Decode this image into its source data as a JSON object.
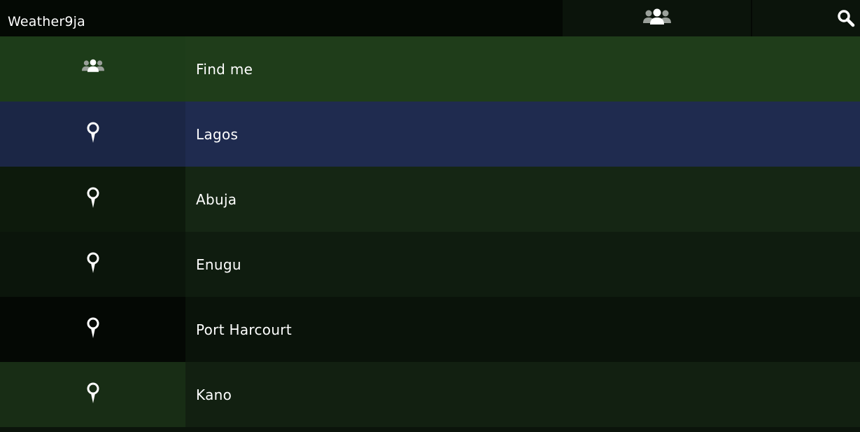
{
  "header": {
    "title": "Weather9ja",
    "people_icon": "people-group-icon",
    "search_icon": "search-icon"
  },
  "list": {
    "items": [
      {
        "label": "Find me",
        "icon": "people-group-icon"
      },
      {
        "label": "Lagos",
        "icon": "map-pin-icon",
        "selected": true
      },
      {
        "label": "Abuja",
        "icon": "map-pin-icon"
      },
      {
        "label": "Enugu",
        "icon": "map-pin-icon"
      },
      {
        "label": "Port Harcourt",
        "icon": "map-pin-icon"
      },
      {
        "label": "Kano",
        "icon": "map-pin-icon"
      }
    ]
  },
  "colors": {
    "selected_row": "#1f2b4f",
    "find_me_row": "#1f3d1a",
    "topbar": "#040904"
  }
}
